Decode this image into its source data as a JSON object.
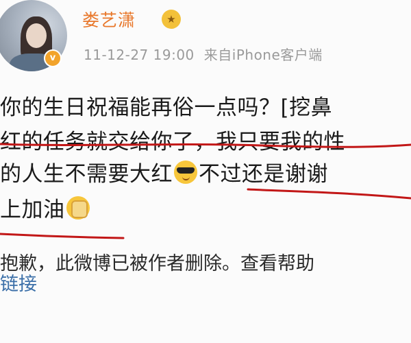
{
  "post": {
    "username": "娄艺潇",
    "verified_badge": "v",
    "timestamp": "11-12-27 19:00",
    "source": "来自iPhone客户端",
    "lines": [
      "你的生日祝福能再俗一点吗？[挖鼻",
      "红的任务就交给你了，我只要我的性",
      "的人生不需要大红",
      "不过还是谢谢",
      "上加油"
    ],
    "emojis": [
      "sunglasses-emoji",
      "fist-emoji"
    ]
  },
  "notice": {
    "deleted_text": "抱歉，此微博已被作者删除。查看帮助",
    "link_text": "链接"
  },
  "colors": {
    "username": "#e8772a",
    "meta": "#9a9a9a",
    "underline": "#c21717",
    "link": "#3b6fa8"
  }
}
